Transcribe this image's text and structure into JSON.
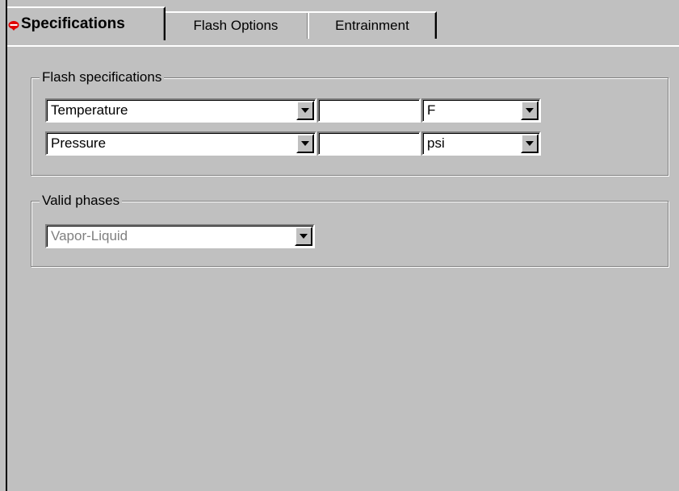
{
  "tabs": [
    {
      "label": "Specifications",
      "active": true,
      "icon": "red-heart-icon"
    },
    {
      "label": "Flash Options",
      "active": false
    },
    {
      "label": "Entrainment",
      "active": false
    }
  ],
  "flash_specifications": {
    "legend": "Flash specifications",
    "rows": [
      {
        "spec": "Temperature",
        "value": "",
        "unit": "F"
      },
      {
        "spec": "Pressure",
        "value": "",
        "unit": "psi"
      }
    ]
  },
  "valid_phases": {
    "legend": "Valid phases",
    "selected": "Vapor-Liquid",
    "enabled": false
  },
  "colors": {
    "background": "#c0c0c0",
    "icon": "#e00000"
  }
}
